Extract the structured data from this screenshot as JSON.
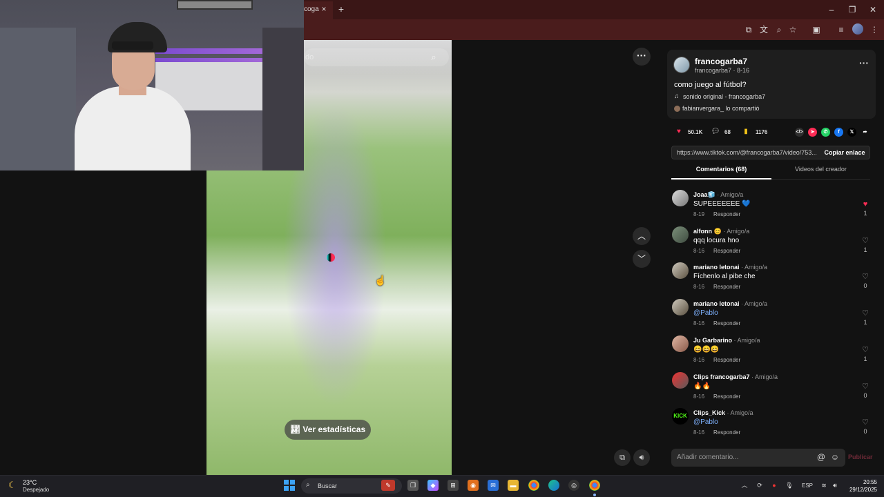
{
  "browser": {
    "tab_title": "coga",
    "tab_close_icon": "×",
    "new_tab_icon": "+",
    "window_controls": [
      "–",
      "❐",
      "✕"
    ]
  },
  "video": {
    "search_placeholder": "do",
    "stats_button_label": "Ver estadísticas"
  },
  "post": {
    "username": "francogarba7",
    "subline": "francogarba7 · 8-16",
    "caption": "como juego al fútbol?",
    "music": "sonido original - francogarba7",
    "shared_by": "fabianvergara_ lo compartió",
    "likes": "50.1K",
    "comments_count": "68",
    "saves": "1176",
    "link": "https://www.tiktok.com/@francogarba7/video/753...",
    "copy_link_label": "Copiar enlace",
    "tab_comments": "Comentarios (68)",
    "tab_creator": "Videos del creador"
  },
  "comments": [
    {
      "user": "Joaa🧊",
      "tag": " · Amigo/a",
      "text": "SUPEEEEEEE 💙",
      "date": "8-19",
      "reply": "Responder",
      "likes": "1",
      "liked": true
    },
    {
      "user": "alfonn 😊",
      "tag": " · Amigo/a",
      "text": "qqq locura hno",
      "date": "8-16",
      "reply": "Responder",
      "likes": "1",
      "liked": false
    },
    {
      "user": "mariano letonai",
      "tag": " · Amigo/a",
      "text": "Fíchenlo al pibe che",
      "date": "8-16",
      "reply": "Responder",
      "likes": "0",
      "liked": false
    },
    {
      "user": "mariano letonai",
      "tag": " · Amigo/a",
      "text": "@Pablo",
      "date": "8-16",
      "reply": "Responder",
      "likes": "1",
      "liked": false,
      "mention": true
    },
    {
      "user": "Ju Garbarino",
      "tag": " · Amigo/a",
      "text": "😄😄😄",
      "date": "8-16",
      "reply": "Responder",
      "likes": "1",
      "liked": false
    },
    {
      "user": "Clips francogarba7",
      "tag": " · Amigo/a",
      "text": "🔥🔥",
      "date": "8-16",
      "reply": "Responder",
      "likes": "0",
      "liked": false
    },
    {
      "user": "Clips_Kick",
      "tag": " · Amigo/a",
      "text": "@Pablo",
      "date": "8-16",
      "reply": "Responder",
      "likes": "0",
      "liked": false,
      "mention": true
    }
  ],
  "comment_box": {
    "placeholder": "Añadir comentario...",
    "post_label": "Publicar"
  },
  "taskbar": {
    "temp": "23°C",
    "weather": "Despejado",
    "search_label": "Buscar",
    "lang": "ESP",
    "time": "20:55",
    "date": "29/12/2025"
  },
  "colors": {
    "accent": "#fe2c55",
    "mention": "#7fb2ff",
    "chrome_bg": "#4a1c1c"
  }
}
